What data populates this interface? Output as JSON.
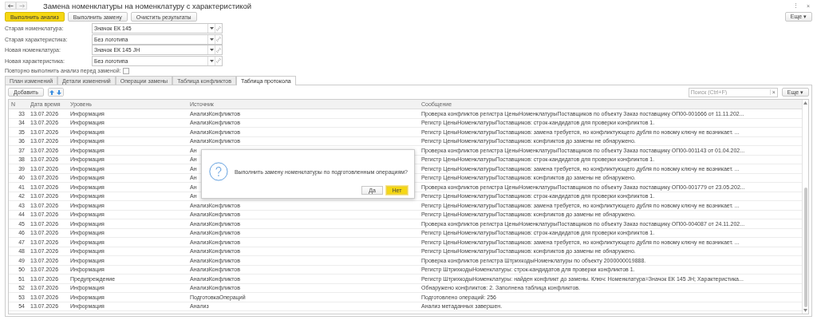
{
  "window": {
    "title": "Замена номенклатуры на номенклатуру с характеристикой",
    "more_menu": "⋮",
    "close": "×"
  },
  "commands": [
    {
      "label": "Выполнить анализ",
      "default": true
    },
    {
      "label": "Выполнить замену",
      "default": false
    },
    {
      "label": "Очистить результаты",
      "default": false
    }
  ],
  "more_button": "Еще ▾",
  "fields": [
    {
      "label": "Старая номенклатура:",
      "value": "Значок ЕК 145"
    },
    {
      "label": "Старая характеристика:",
      "value": "Без логотипа"
    },
    {
      "label": "Новая номенклатура:",
      "value": "Значок ЕК 145 JH"
    },
    {
      "label": "Новая характеристика:",
      "value": "Без логотипа"
    }
  ],
  "repeat_analysis": {
    "label": "Повторно выполнить анализ перед заменой:",
    "checked": false
  },
  "tabs": [
    {
      "label": "План изменений",
      "selected": false
    },
    {
      "label": "Детали изменений",
      "selected": false
    },
    {
      "label": "Операции замены",
      "selected": false
    },
    {
      "label": "Таблица конфликтов",
      "selected": false
    },
    {
      "label": "Таблица протокола",
      "selected": true
    }
  ],
  "toolbar": {
    "add": "Добавить",
    "search": {
      "placeholder": "Поиск (Ctrl+F)",
      "clear": "×"
    },
    "more": "Еще ▾"
  },
  "table": {
    "columns": [
      "N",
      "Дата время",
      "Уровень",
      "Источник",
      "Сообщение"
    ],
    "rows": [
      [
        "33",
        "13.07.2026",
        "Информация",
        "АнализКонфликтов",
        "Проверка конфликтов регистра ЦеныНоменклатурыПоставщиков по объекту Заказ поставщику ОП00-001666 от 11.11.202..."
      ],
      [
        "34",
        "13.07.2026",
        "Информация",
        "АнализКонфликтов",
        "Регистр ЦеныНоменклатурыПоставщиков: строк-кандидатов для проверки конфликтов 1."
      ],
      [
        "35",
        "13.07.2026",
        "Информация",
        "АнализКонфликтов",
        "Регистр ЦеныНоменклатурыПоставщиков: замена требуется, но конфликтующего дубля по новому ключу не возникает. ..."
      ],
      [
        "36",
        "13.07.2026",
        "Информация",
        "АнализКонфликтов",
        "Регистр ЦеныНоменклатурыПоставщиков: конфликтов до замены не обнаружено."
      ],
      [
        "37",
        "13.07.2026",
        "Информация",
        "Ан",
        "Проверка конфликтов регистра ЦеныНоменклатурыПоставщиков по объекту Заказ поставщику ОП00-001143 от 01.04.202..."
      ],
      [
        "38",
        "13.07.2026",
        "Информация",
        "Ан",
        "Регистр ЦеныНоменклатурыПоставщиков: строк-кандидатов для проверки конфликтов 1."
      ],
      [
        "39",
        "13.07.2026",
        "Информация",
        "Ан",
        "Регистр ЦеныНоменклатурыПоставщиков: замена требуется, но конфликтующего дубля по новому ключу не возникает. ..."
      ],
      [
        "40",
        "13.07.2026",
        "Информация",
        "Ан",
        "Регистр ЦеныНоменклатурыПоставщиков: конфликтов до замены не обнаружено."
      ],
      [
        "41",
        "13.07.2026",
        "Информация",
        "Ан",
        "Проверка конфликтов регистра ЦеныНоменклатурыПоставщиков по объекту Заказ поставщику ОП00-001779 от 23.05.202..."
      ],
      [
        "42",
        "13.07.2026",
        "Информация",
        "Ан",
        "Регистр ЦеныНоменклатурыПоставщиков: строк-кандидатов для проверки конфликтов 1."
      ],
      [
        "43",
        "13.07.2026",
        "Информация",
        "АнализКонфликтов",
        "Регистр ЦеныНоменклатурыПоставщиков: замена требуется, но конфликтующего дубля по новому ключу не возникает. ..."
      ],
      [
        "44",
        "13.07.2026",
        "Информация",
        "АнализКонфликтов",
        "Регистр ЦеныНоменклатурыПоставщиков: конфликтов до замены не обнаружено."
      ],
      [
        "45",
        "13.07.2026",
        "Информация",
        "АнализКонфликтов",
        "Проверка конфликтов регистра ЦеныНоменклатурыПоставщиков по объекту Заказ поставщику ОП00-004087 от 24.11.202..."
      ],
      [
        "46",
        "13.07.2026",
        "Информация",
        "АнализКонфликтов",
        "Регистр ЦеныНоменклатурыПоставщиков: строк-кандидатов для проверки конфликтов 1."
      ],
      [
        "47",
        "13.07.2026",
        "Информация",
        "АнализКонфликтов",
        "Регистр ЦеныНоменклатурыПоставщиков: замена требуется, но конфликтующего дубля по новому ключу не возникает. ..."
      ],
      [
        "48",
        "13.07.2026",
        "Информация",
        "АнализКонфликтов",
        "Регистр ЦеныНоменклатурыПоставщиков: конфликтов до замены не обнаружено."
      ],
      [
        "49",
        "13.07.2026",
        "Информация",
        "АнализКонфликтов",
        "Проверка конфликтов регистра ШтрихкодыНоменклатуры по объекту 2000000019888."
      ],
      [
        "50",
        "13.07.2026",
        "Информация",
        "АнализКонфликтов",
        "Регистр ШтрихкодыНоменклатуры: строк-кандидатов для проверки конфликтов 1."
      ],
      [
        "51",
        "13.07.2026",
        "Предупреждение",
        "АнализКонфликтов",
        "Регистр ШтрихкодыНоменклатуры: найден конфликт до замены. Ключ: Номенклатура=Значок ЕК 145 JH; Характеристика..."
      ],
      [
        "52",
        "13.07.2026",
        "Информация",
        "АнализКонфликтов",
        "Обнаружено конфликтов: 2. Заполнена таблица конфликтов."
      ],
      [
        "53",
        "13.07.2026",
        "Информация",
        "ПодготовкаОпераций",
        "Подготовлено операций: 256"
      ],
      [
        "54",
        "13.07.2026",
        "Информация",
        "Анализ",
        "Анализ метаданных завершен."
      ]
    ]
  },
  "dialog": {
    "message": "Выполнить замену номенклатуры по подготовленным операциям?",
    "buttons": [
      {
        "label": "Да",
        "default": false
      },
      {
        "label": "Нет",
        "default": true
      }
    ]
  }
}
